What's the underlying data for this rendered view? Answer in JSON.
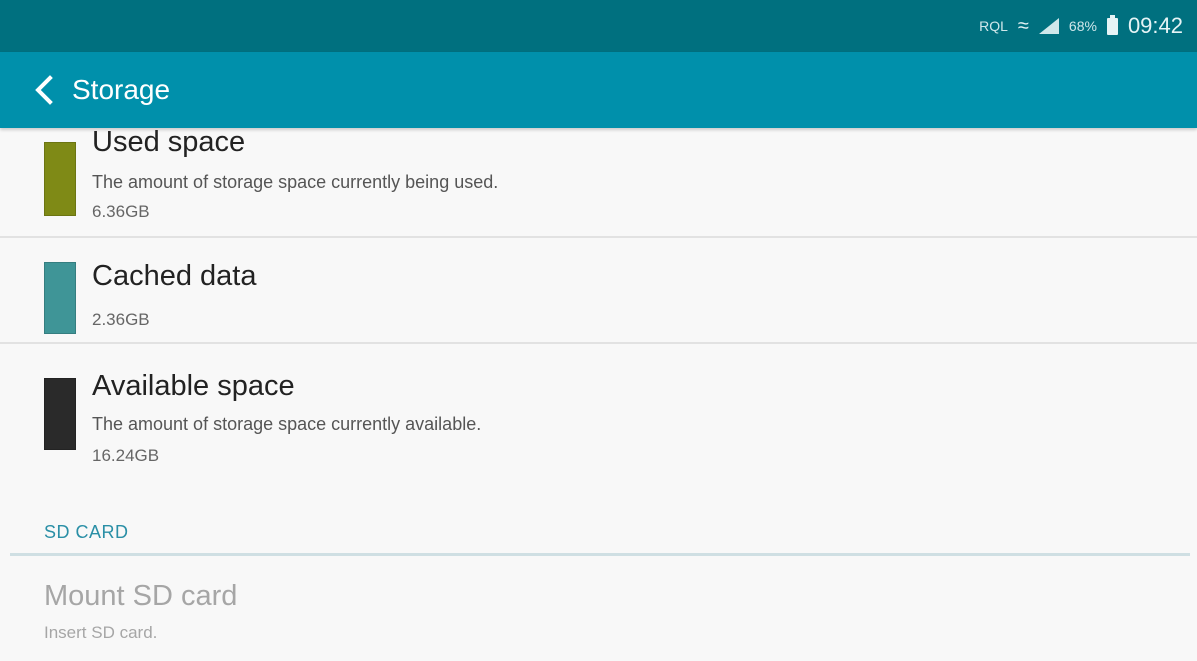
{
  "status_bar": {
    "notification_text": "RQL",
    "battery_percent": "68%",
    "time": "09:42",
    "icons": [
      "wifi-icon",
      "signal-icon",
      "battery-icon"
    ]
  },
  "app_bar": {
    "title": "Storage",
    "back_icon": "chevron-left-icon",
    "background": "#0090ab"
  },
  "storage_items": [
    {
      "title": "Used space",
      "summary": "The amount of storage space currently being used.",
      "value": "6.36GB",
      "color": "#7f8a16"
    },
    {
      "title": "Cached data",
      "summary": "",
      "value": "2.36GB",
      "color": "#3f9597"
    },
    {
      "title": "Available space",
      "summary": "The amount of storage space currently available.",
      "value": "16.24GB",
      "color": "#2a2a2a"
    }
  ],
  "sd_card": {
    "section_title": "SD CARD",
    "mount_title": "Mount SD card",
    "mount_summary": "Insert SD card."
  }
}
